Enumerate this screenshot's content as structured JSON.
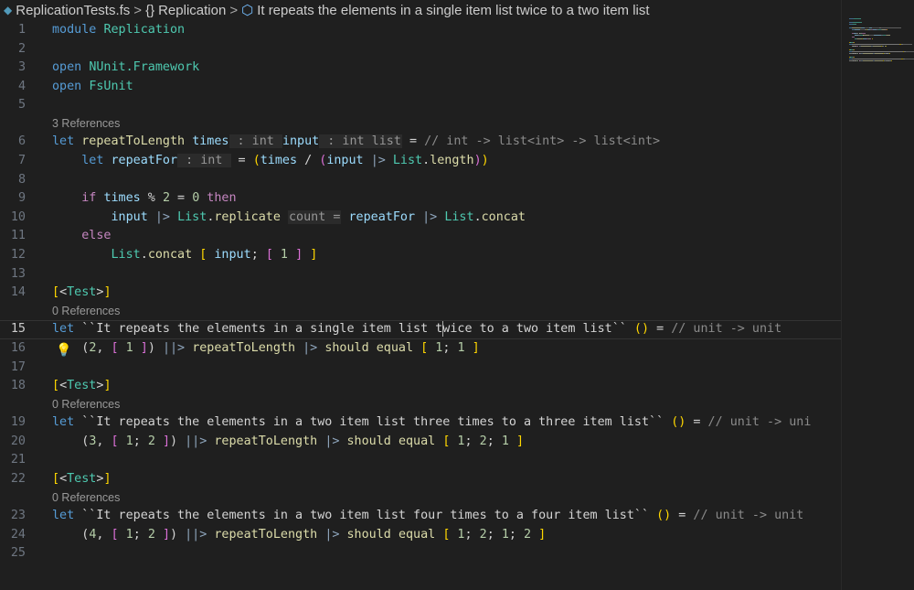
{
  "breadcrumb": {
    "file": "ReplicationTests.fs",
    "namespace": "Replication",
    "symbol": "It repeats the elements in a single item list twice to a two item list"
  },
  "lines": [
    {
      "n": "1",
      "tokens": [
        [
          "k",
          "module "
        ],
        [
          "t",
          "Replication"
        ]
      ]
    },
    {
      "n": "2",
      "tokens": []
    },
    {
      "n": "3",
      "tokens": [
        [
          "k",
          "open "
        ],
        [
          "t",
          "NUnit.Framework"
        ]
      ]
    },
    {
      "n": "4",
      "tokens": [
        [
          "k",
          "open "
        ],
        [
          "t",
          "FsUnit"
        ]
      ]
    },
    {
      "n": "5",
      "tokens": []
    },
    {
      "lens": "3 References"
    },
    {
      "n": "6",
      "tokens": [
        [
          "k",
          "let "
        ],
        [
          "f",
          "repeatToLength "
        ],
        [
          "v",
          "times"
        ],
        [
          "h",
          " : int "
        ],
        [
          "v",
          "input"
        ],
        [
          "h",
          " : int list"
        ],
        [
          "p",
          " = "
        ],
        [
          "g",
          "// int -> list<int> -> list<int>"
        ]
      ]
    },
    {
      "n": "7",
      "tokens": [
        [
          "p",
          "    "
        ],
        [
          "k",
          "let "
        ],
        [
          "v",
          "repeatFor"
        ],
        [
          "h",
          " : int "
        ],
        [
          "p",
          " = "
        ],
        [
          "b1",
          "("
        ],
        [
          "v",
          "times"
        ],
        [
          "p",
          " / "
        ],
        [
          "b2",
          "("
        ],
        [
          "v",
          "input "
        ],
        [
          "o",
          "|> "
        ],
        [
          "t",
          "List"
        ],
        [
          "p",
          "."
        ],
        [
          "f",
          "length"
        ],
        [
          "b2",
          ")"
        ],
        [
          "b1",
          ")"
        ]
      ]
    },
    {
      "n": "8",
      "tokens": []
    },
    {
      "n": "9",
      "tokens": [
        [
          "p",
          "    "
        ],
        [
          "c",
          "if "
        ],
        [
          "v",
          "times"
        ],
        [
          "p",
          " % "
        ],
        [
          "n",
          "2"
        ],
        [
          "p",
          " = "
        ],
        [
          "n",
          "0"
        ],
        [
          "c",
          " then"
        ]
      ]
    },
    {
      "n": "10",
      "tokens": [
        [
          "p",
          "        "
        ],
        [
          "v",
          "input "
        ],
        [
          "o",
          "|> "
        ],
        [
          "t",
          "List"
        ],
        [
          "p",
          "."
        ],
        [
          "f",
          "replicate "
        ],
        [
          "h",
          "count ="
        ],
        [
          "v",
          " repeatFor "
        ],
        [
          "o",
          "|> "
        ],
        [
          "t",
          "List"
        ],
        [
          "p",
          "."
        ],
        [
          "f",
          "concat"
        ]
      ]
    },
    {
      "n": "11",
      "tokens": [
        [
          "p",
          "    "
        ],
        [
          "c",
          "else"
        ]
      ]
    },
    {
      "n": "12",
      "tokens": [
        [
          "p",
          "        "
        ],
        [
          "t",
          "List"
        ],
        [
          "p",
          "."
        ],
        [
          "f",
          "concat "
        ],
        [
          "b1",
          "["
        ],
        [
          "v",
          " input"
        ],
        [
          "p",
          "; "
        ],
        [
          "b2",
          "["
        ],
        [
          "n",
          " 1 "
        ],
        [
          "b2",
          "]"
        ],
        [
          "p",
          " "
        ],
        [
          "b1",
          "]"
        ]
      ]
    },
    {
      "n": "13",
      "tokens": []
    },
    {
      "n": "14",
      "tokens": [
        [
          "b1",
          "["
        ],
        [
          "p",
          "<"
        ],
        [
          "t",
          "Test"
        ],
        [
          "p",
          ">"
        ],
        [
          "b1",
          "]"
        ]
      ]
    },
    {
      "lens": "0 References"
    },
    {
      "n": "15",
      "cur": true,
      "tokens": [
        [
          "k",
          "let "
        ],
        [
          "p",
          "``It repeats the elements in a single item list t"
        ],
        [
          "cursor",
          ""
        ],
        [
          "p",
          "wice to a two item list`` "
        ],
        [
          "b1",
          "()"
        ],
        [
          "p",
          " = "
        ],
        [
          "g",
          "// unit -> unit"
        ]
      ]
    },
    {
      "n": "16",
      "bulb": true,
      "tokens": [
        [
          "p",
          "    "
        ],
        [
          "p",
          "("
        ],
        [
          "n",
          "2"
        ],
        [
          "p",
          ", "
        ],
        [
          "b2",
          "["
        ],
        [
          "n",
          " 1 "
        ],
        [
          "b2",
          "]"
        ],
        [
          "p",
          ") "
        ],
        [
          "o",
          "||> "
        ],
        [
          "f",
          "repeatToLength "
        ],
        [
          "o",
          "|> "
        ],
        [
          "f",
          "should "
        ],
        [
          "f",
          "equal "
        ],
        [
          "b1",
          "["
        ],
        [
          "n",
          " 1"
        ],
        [
          "p",
          "; "
        ],
        [
          "n",
          "1 "
        ],
        [
          "b1",
          "]"
        ]
      ]
    },
    {
      "n": "17",
      "tokens": []
    },
    {
      "n": "18",
      "tokens": [
        [
          "b1",
          "["
        ],
        [
          "p",
          "<"
        ],
        [
          "t",
          "Test"
        ],
        [
          "p",
          ">"
        ],
        [
          "b1",
          "]"
        ]
      ]
    },
    {
      "lens": "0 References"
    },
    {
      "n": "19",
      "tokens": [
        [
          "k",
          "let "
        ],
        [
          "p",
          "``It repeats the elements in a two item list three times to a three item list`` "
        ],
        [
          "b1",
          "()"
        ],
        [
          "p",
          " = "
        ],
        [
          "g",
          "// unit -> uni"
        ]
      ]
    },
    {
      "n": "20",
      "tokens": [
        [
          "p",
          "    ("
        ],
        [
          "n",
          "3"
        ],
        [
          "p",
          ", "
        ],
        [
          "b2",
          "["
        ],
        [
          "n",
          " 1"
        ],
        [
          "p",
          "; "
        ],
        [
          "n",
          "2 "
        ],
        [
          "b2",
          "]"
        ],
        [
          "p",
          ") "
        ],
        [
          "o",
          "||> "
        ],
        [
          "f",
          "repeatToLength "
        ],
        [
          "o",
          "|> "
        ],
        [
          "f",
          "should "
        ],
        [
          "f",
          "equal "
        ],
        [
          "b1",
          "["
        ],
        [
          "n",
          " 1"
        ],
        [
          "p",
          "; "
        ],
        [
          "n",
          "2"
        ],
        [
          "p",
          "; "
        ],
        [
          "n",
          "1 "
        ],
        [
          "b1",
          "]"
        ]
      ]
    },
    {
      "n": "21",
      "tokens": []
    },
    {
      "n": "22",
      "tokens": [
        [
          "b1",
          "["
        ],
        [
          "p",
          "<"
        ],
        [
          "t",
          "Test"
        ],
        [
          "p",
          ">"
        ],
        [
          "b1",
          "]"
        ]
      ]
    },
    {
      "lens": "0 References"
    },
    {
      "n": "23",
      "tokens": [
        [
          "k",
          "let "
        ],
        [
          "p",
          "``It repeats the elements in a two item list four times to a four item list`` "
        ],
        [
          "b1",
          "()"
        ],
        [
          "p",
          " = "
        ],
        [
          "g",
          "// unit -> unit"
        ]
      ]
    },
    {
      "n": "24",
      "tokens": [
        [
          "p",
          "    ("
        ],
        [
          "n",
          "4"
        ],
        [
          "p",
          ", "
        ],
        [
          "b2",
          "["
        ],
        [
          "n",
          " 1"
        ],
        [
          "p",
          "; "
        ],
        [
          "n",
          "2 "
        ],
        [
          "b2",
          "]"
        ],
        [
          "p",
          ") "
        ],
        [
          "o",
          "||> "
        ],
        [
          "f",
          "repeatToLength "
        ],
        [
          "o",
          "|> "
        ],
        [
          "f",
          "should "
        ],
        [
          "f",
          "equal "
        ],
        [
          "b1",
          "["
        ],
        [
          "n",
          " 1"
        ],
        [
          "p",
          "; "
        ],
        [
          "n",
          "2"
        ],
        [
          "p",
          "; "
        ],
        [
          "n",
          "1"
        ],
        [
          "p",
          "; "
        ],
        [
          "n",
          "2 "
        ],
        [
          "b1",
          "]"
        ]
      ]
    },
    {
      "n": "25",
      "tokens": []
    }
  ]
}
